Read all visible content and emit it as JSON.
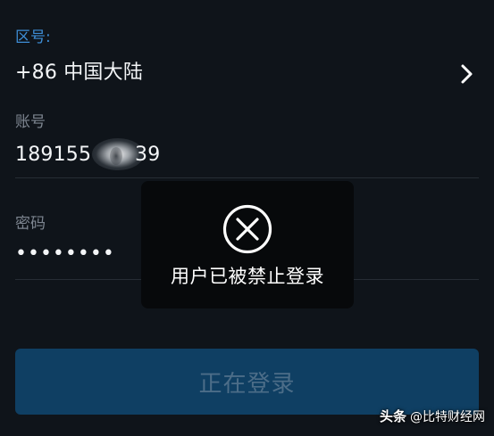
{
  "region": {
    "label": "区号:",
    "value": "+86 中国大陆"
  },
  "account": {
    "label": "账号",
    "value_prefix": "189155",
    "value_suffix": "39"
  },
  "password": {
    "label": "密码",
    "value": "••••••••"
  },
  "login_button": {
    "label": "正在登录"
  },
  "toast": {
    "icon": "circle-x-icon",
    "message": "用户已被禁止登录"
  },
  "watermark": {
    "brand": "头条",
    "handle": "@比特财经网"
  },
  "colors": {
    "background": "#0f141a",
    "accent": "#3e8ed7",
    "button": "#0f3f63",
    "toast": "#07090b"
  }
}
